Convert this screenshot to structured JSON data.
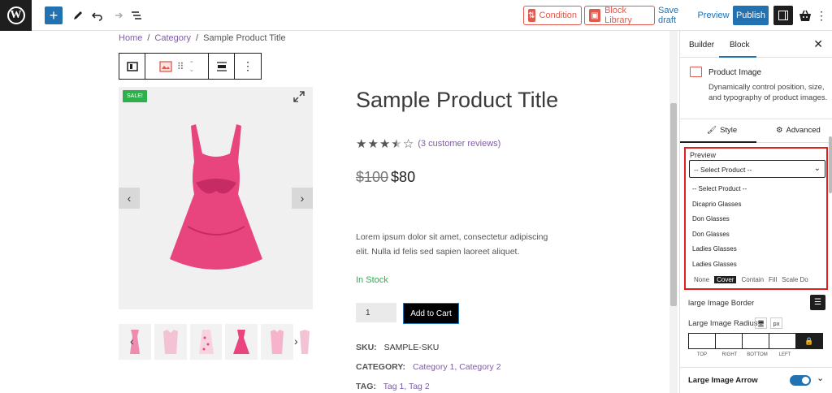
{
  "topbar": {
    "condition_label": "Condition",
    "block_library_label": "Block Library",
    "save_draft_label": "Save draft",
    "preview_label": "Preview",
    "publish_label": "Publish"
  },
  "breadcrumb": {
    "home": "Home",
    "sep": "/",
    "category": "Category",
    "current": "Sample Product Title"
  },
  "product": {
    "sale_badge": "SALE!",
    "title": "Sample Product Title",
    "rating": 4,
    "reviews_text": "(3 customer reviews)",
    "old_price": "$100",
    "new_price": "$80",
    "description": "Lorem ipsum dolor sit amet, consectetur adipiscing elit. Nulla id felis sed sapien laoreet aliquet.",
    "stock": "In Stock",
    "quantity": "1",
    "add_to_cart": "Add to Cart",
    "sku_label": "SKU:",
    "sku_value": "SAMPLE-SKU",
    "category_label": "CATEGORY:",
    "categories": [
      "Category 1",
      "Category 2"
    ],
    "tag_label": "TAG:",
    "tags": [
      "Tag 1",
      "Tag 2"
    ],
    "primary_color": "#e8457e"
  },
  "sidebar": {
    "tabs": [
      "Builder",
      "Block"
    ],
    "active_tab": "Block",
    "block_title": "Product Image",
    "block_desc": "Dynamically control position, size, and typography of product images.",
    "style_tabs": [
      "Style",
      "Advanced"
    ],
    "active_style_tab": "Style",
    "preview_label": "Preview",
    "select_value": "-- Select Product --",
    "dropdown_options": [
      "-- Select Product --",
      "Dicaprio Glasses",
      "Don Glasses",
      "Don Glasses",
      "Ladies Glasses",
      "Ladies Glasses"
    ],
    "behind_options": [
      "None",
      "Cover",
      "Contain",
      "Fill",
      "Scale Do"
    ],
    "large_image_border": "large Image Border",
    "large_image_radius": "Large Image Radius",
    "radius_unit": "px",
    "radius_labels": [
      "TOP",
      "RIGHT",
      "BOTTOM",
      "LEFT"
    ],
    "large_image_arrow": "Large Image Arrow"
  }
}
